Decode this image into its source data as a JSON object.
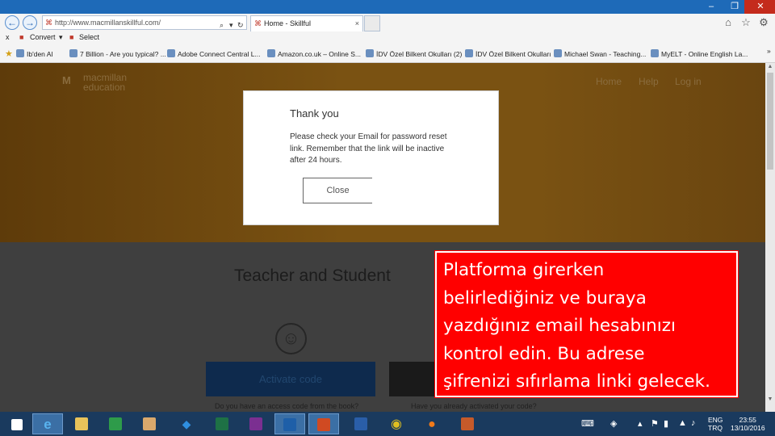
{
  "browser": {
    "address_url": "http://www.macmillanskillful.com/",
    "tab_title": "Home - Skillful",
    "tab_close": "×",
    "window_controls": {
      "minimize": "–",
      "restore": "❐",
      "close": "✕"
    },
    "command_bar": {
      "close": "x",
      "convert": "Convert",
      "select": "Select"
    },
    "favorites": [
      "Ib'den Al",
      "7 Billion - Are you typical? ...",
      "Adobe Connect Central L...",
      "Amazon.co.uk – Online S...",
      "İDV Özel Bilkent Okulları (2)",
      "İDV Özel Bilkent Okulları",
      "Michael Swan - Teaching...",
      "MyELT - Online English La..."
    ],
    "favorites_chevron": "»"
  },
  "site": {
    "logo_line1": "macmillan",
    "logo_line2": "education",
    "nav": [
      "Home",
      "Help",
      "Log in"
    ],
    "section_title": "Teacher and Student",
    "activate_button": "Activate code",
    "access_question": "Do you have an access code from the book?",
    "activated_question": "Have you already activated your code?"
  },
  "modal": {
    "title": "Thank you",
    "body": "Please check your Email for password reset link. Remember that the link will be inactive after 24 hours.",
    "close_button": "Close"
  },
  "callout": {
    "lines": [
      "Platforma girerken",
      "belirlediğiniz ve buraya",
      "yazdığınız email hesabınızı",
      "kontrol edin. Bu adrese",
      "şifrenizi sıfırlama linki gelecek."
    ],
    "background": "#ff0000"
  },
  "taskbar": {
    "apps": [
      "windows-start-icon",
      "internet-explorer-icon",
      "file-explorer-icon",
      "store-icon",
      "photos-icon",
      "dropbox-icon",
      "excel-icon",
      "onenote-icon",
      "outlook-icon",
      "powerpoint-icon",
      "word-icon",
      "chrome-icon",
      "firefox-icon",
      "app-icon"
    ],
    "language_line1": "ENG",
    "language_line2": "TRQ",
    "time": "23:55",
    "date": "13/10/2016"
  },
  "colors": {
    "titlebar": "#1e6ab8",
    "hero": "#7a5212",
    "activate_button": "#0e2a4d",
    "taskbar": "#1a3a5e"
  }
}
